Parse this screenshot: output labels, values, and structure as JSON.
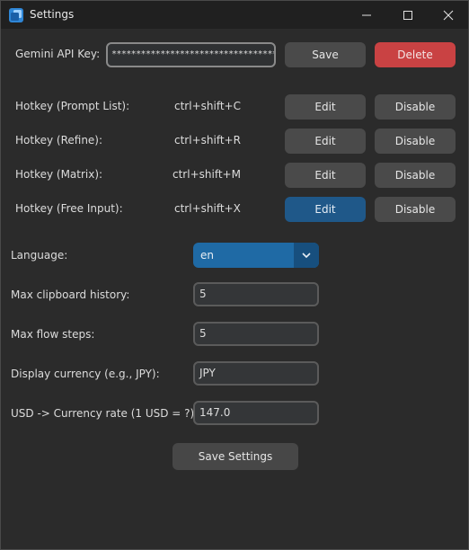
{
  "window": {
    "title": "Settings"
  },
  "api_key": {
    "label": "Gemini API Key:",
    "masked_value": "****************************************",
    "save_label": "Save",
    "delete_label": "Delete"
  },
  "hotkeys": [
    {
      "label": "Hotkey (Prompt List):",
      "value": "ctrl+shift+C",
      "edit_label": "Edit",
      "disable_label": "Disable"
    },
    {
      "label": "Hotkey (Refine):",
      "value": "ctrl+shift+R",
      "edit_label": "Edit",
      "disable_label": "Disable"
    },
    {
      "label": "Hotkey (Matrix):",
      "value": "ctrl+shift+M",
      "edit_label": "Edit",
      "disable_label": "Disable"
    },
    {
      "label": "Hotkey (Free Input):",
      "value": "ctrl+shift+X",
      "edit_label": "Edit",
      "disable_label": "Disable"
    }
  ],
  "settings": {
    "language_label": "Language:",
    "language_value": "en",
    "clipboard_label": "Max clipboard history:",
    "clipboard_value": "5",
    "flow_label": "Max flow steps:",
    "flow_value": "5",
    "currency_label": "Display currency (e.g., JPY):",
    "currency_value": "JPY",
    "rate_label": "USD -> Currency rate (1 USD = ?)",
    "rate_value": "147.0"
  },
  "save_settings_label": "Save Settings",
  "colors": {
    "background": "#2b2b2b",
    "button": "#4a4a4a",
    "delete": "#c94243",
    "accent": "#1f6aa5",
    "edit_active": "#1f5889"
  }
}
